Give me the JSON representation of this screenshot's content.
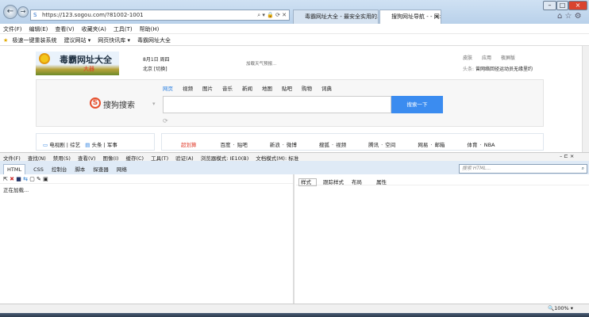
{
  "browser": {
    "url": "https://123.sogou.com/?81002-1001",
    "tabs": [
      {
        "label": "毒霸网址大全 - 最安全实用的..."
      },
      {
        "label": "搜狗网址导航 - - 网址大全,..."
      }
    ],
    "menu": [
      "文件(F)",
      "编辑(E)",
      "查看(V)",
      "收藏夹(A)",
      "工具(T)",
      "帮助(H)"
    ],
    "favorites": [
      "极速一键重装系统",
      "建议网站 ▾",
      "网页快讯库 ▾",
      "毒霸网址大全"
    ],
    "zoom": "100%"
  },
  "page": {
    "logo_title": "毒霸网址大全",
    "logo_sub": "大器",
    "date": "8月1日 周四",
    "city": "北京 [切换]",
    "weather": "加载天气预报...",
    "top_links": [
      "皮肤",
      "应用",
      "夜屏版"
    ],
    "headline_label": "头条:",
    "headline": "曾网络回径运动员无缘里约",
    "search_brand": "搜狗搜索",
    "search_tabs": [
      "网页",
      "视频",
      "图片",
      "音乐",
      "新闻",
      "地图",
      "贴吧",
      "购物",
      "词典"
    ],
    "search_button": "搜索一下",
    "left_links": [
      "电视剧",
      "综艺",
      "头条",
      "军事"
    ],
    "site_links": [
      "超划算",
      "百度 · 贴吧",
      "新浪 · 微博",
      "搜狐 · 视频",
      "腾讯 · 空间",
      "网易 · 邮箱",
      "体育 · NBA"
    ]
  },
  "devtools": {
    "menu": [
      "文件(F)",
      "查找(N)",
      "禁用(S)",
      "查看(V)",
      "图像(I)",
      "缓存(C)",
      "工具(T)",
      "验证(A)",
      "浏览器模式: IE10(B)",
      "文档模式(M): 标准"
    ],
    "tabs": [
      "HTML",
      "CSS",
      "控制台",
      "脚本",
      "探查器",
      "网络"
    ],
    "search_placeholder": "搜索 HTML...",
    "loading": "正在加载...",
    "right_tabs": [
      "样式",
      "跟踪样式",
      "布局",
      "属性"
    ]
  }
}
